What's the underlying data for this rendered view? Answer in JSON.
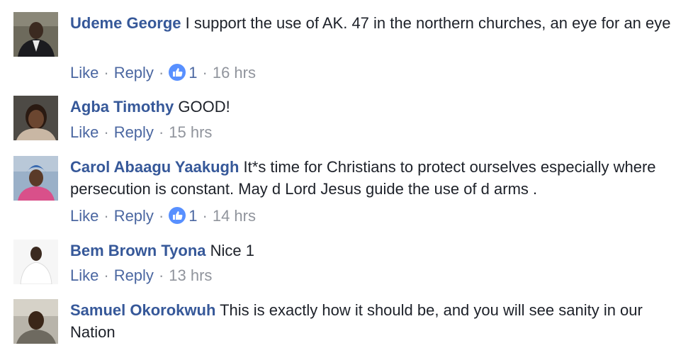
{
  "comments": [
    {
      "author": "Udeme George",
      "text": "I support the use of AK. 47 in the northern churches, an eye for an eye",
      "like_label": "Like",
      "reply_label": "Reply",
      "reaction_count": "1",
      "timestamp": "16 hrs"
    },
    {
      "author": "Agba Timothy",
      "text": "GOOD!",
      "like_label": "Like",
      "reply_label": "Reply",
      "timestamp": "15 hrs"
    },
    {
      "author": "Carol Abaagu Yaakugh",
      "text": "It*s time for Christians to protect ourselves especially where persecution is constant. May d Lord Jesus guide the use of d arms .",
      "like_label": "Like",
      "reply_label": "Reply",
      "reaction_count": "1",
      "timestamp": "14 hrs"
    },
    {
      "author": "Bem Brown Tyona",
      "text": "Nice 1",
      "like_label": "Like",
      "reply_label": "Reply",
      "timestamp": "13 hrs"
    },
    {
      "author": "Samuel Okorokwuh",
      "text": "This is exactly how it should be, and you will see sanity in our Nation"
    }
  ],
  "icons": {
    "reaction": "like-thumb-icon",
    "separator": "·"
  },
  "colors": {
    "author": "#365899",
    "link": "#4b67a1",
    "meta": "#90949c",
    "text": "#1d2129",
    "like_badge": "#5890ff"
  }
}
